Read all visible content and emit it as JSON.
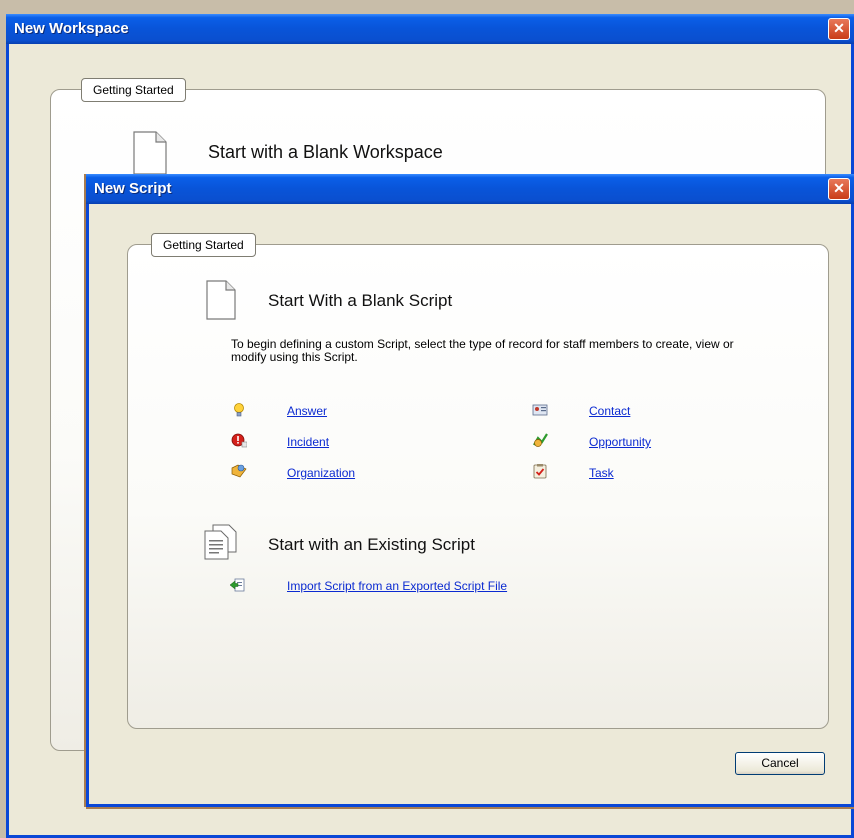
{
  "workspace_window": {
    "title": "New Workspace",
    "close_label": "✕",
    "section_label": "Getting Started",
    "blank_heading": "Start with a Blank Workspace"
  },
  "script_window": {
    "title": "New Script",
    "close_label": "✕",
    "section_label": "Getting Started",
    "blank_heading": "Start With a Blank Script",
    "description": "To begin defining a custom Script, select the type of record for staff members to create, view or modify using this Script.",
    "record_types": [
      {
        "label": "Answer",
        "icon": "lightbulb-icon"
      },
      {
        "label": "Incident",
        "icon": "incident-icon"
      },
      {
        "label": "Organization",
        "icon": "organization-icon"
      },
      {
        "label": "Contact",
        "icon": "contact-card-icon"
      },
      {
        "label": "Opportunity",
        "icon": "opportunity-icon"
      },
      {
        "label": "Task",
        "icon": "task-clipboard-icon"
      }
    ],
    "existing_heading": "Start with an Existing Script",
    "import_link": "Import Script from an Exported Script File",
    "cancel_label": "Cancel"
  }
}
